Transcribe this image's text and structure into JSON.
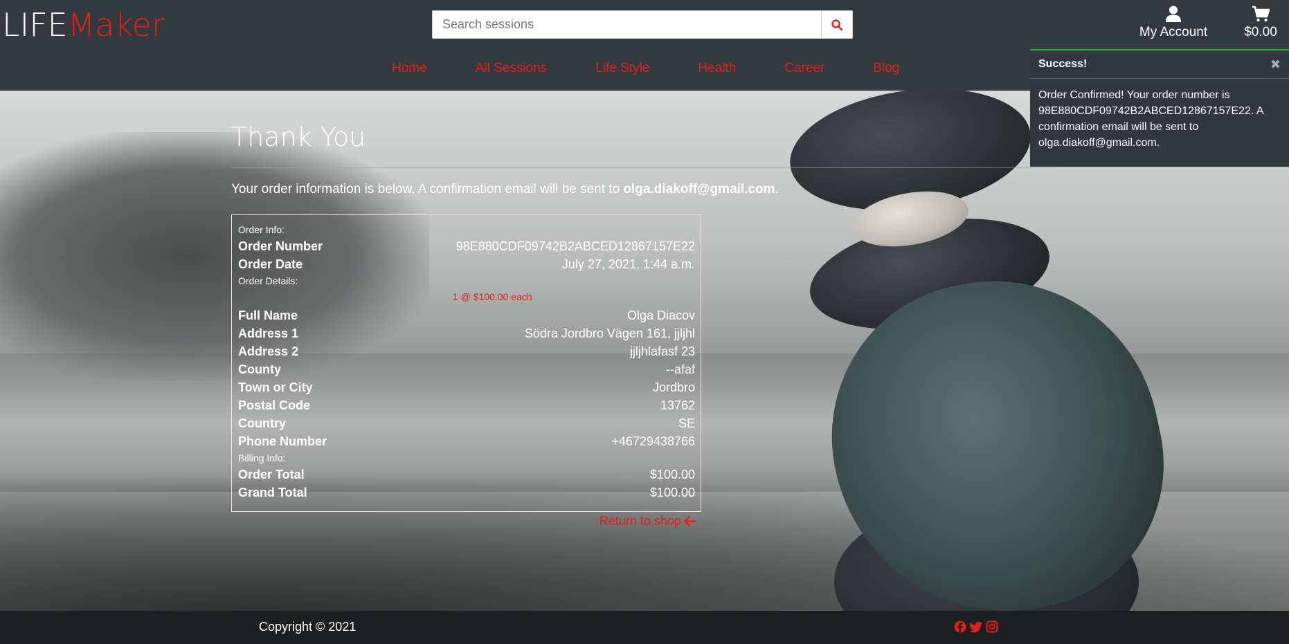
{
  "brand": {
    "part1": "LIFE",
    "part2": "Maker"
  },
  "search": {
    "placeholder": "Search sessions",
    "icon": "search-icon"
  },
  "account": {
    "label": "My Account",
    "icon": "user-icon"
  },
  "cart": {
    "total": "$0.00",
    "icon": "cart-icon"
  },
  "nav": [
    "Home",
    "All Sessions",
    "Life Style",
    "Health",
    "Career",
    "Blog"
  ],
  "colors": {
    "accent": "#e0201c",
    "header_bg": "#353a41",
    "toast_border": "#2fa84a"
  },
  "toast": {
    "title": "Success!",
    "message": "Order Confirmed! Your order number is 98E880CDF09742B2ABCED12867157E22. A confirmation email will be sent to olga.diakoff@gmail.com."
  },
  "page": {
    "title": "Thank You",
    "intro_text": "Your order information is below. A confirmation email will be sent to ",
    "email": "olga.diakoff@gmail.com",
    "intro_end": "."
  },
  "order": {
    "order_info_label": "Order Info:",
    "order_number_label": "Order Number",
    "order_number": "98E880CDF09742B2ABCED12867157E22",
    "order_date_label": "Order Date",
    "order_date": "July 27, 2021, 1:44 a.m.",
    "order_details_label": "Order Details:",
    "line_item": "1 @ $100.00 each",
    "details": [
      {
        "label": "Full Name",
        "value": "Olga Diacov"
      },
      {
        "label": "Address 1",
        "value": "Södra Jordbro Vägen 161, jjljhl"
      },
      {
        "label": "Address 2",
        "value": "jjljhlafasf 23"
      },
      {
        "label": "County",
        "value": "--afaf"
      },
      {
        "label": "Town or City",
        "value": "Jordbro"
      },
      {
        "label": "Postal Code",
        "value": "13762"
      },
      {
        "label": "Country",
        "value": "SE"
      },
      {
        "label": "Phone Number",
        "value": "+46729438766"
      }
    ],
    "billing_label": "Billing Info:",
    "order_total_label": "Order Total",
    "order_total": "$100.00",
    "grand_total_label": "Grand Total",
    "grand_total": "$100.00"
  },
  "return_link": "Return to shop",
  "footer": {
    "copyright": "Copyright © 2021",
    "social": [
      "facebook-icon",
      "twitter-icon",
      "instagram-icon"
    ]
  }
}
